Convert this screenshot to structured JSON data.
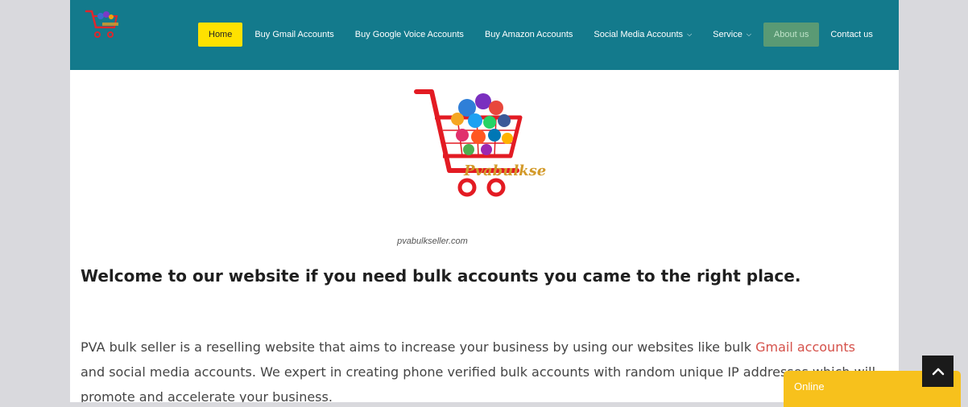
{
  "colors": {
    "header_bg": "#137a8c",
    "home_bg": "#ffe100",
    "about_bg": "#5a9a74",
    "link": "#d5514a",
    "online_bg": "#f7c11c"
  },
  "header": {
    "logo_icon": "cart-logo-icon",
    "nav": [
      {
        "label": "Home",
        "active": true
      },
      {
        "label": "Buy Gmail Accounts"
      },
      {
        "label": "Buy Google Voice Accounts"
      },
      {
        "label": "Buy Amazon Accounts"
      },
      {
        "label": "Social Media Accounts",
        "dropdown": true
      },
      {
        "label": "Service",
        "dropdown": true
      },
      {
        "label": "About us"
      },
      {
        "label": "Contact us"
      }
    ]
  },
  "main": {
    "hero": {
      "brand_text": "Pvabulkseller",
      "caption": "pvabulkseller.com"
    },
    "heading": "Welcome to our website if you need bulk accounts you came to the right place.",
    "paragraph": {
      "before_link": "PVA bulk seller is a reselling website that aims to increase your business by using our websites like bulk ",
      "link_text": "Gmail accounts",
      "after_link": " and social media accounts. We expert in creating phone verified bulk accounts with random unique IP addresses which will promote and accelerate your business."
    }
  },
  "widgets": {
    "scroll_top_icon": "chevron-up-icon",
    "chat_status": "Online"
  }
}
